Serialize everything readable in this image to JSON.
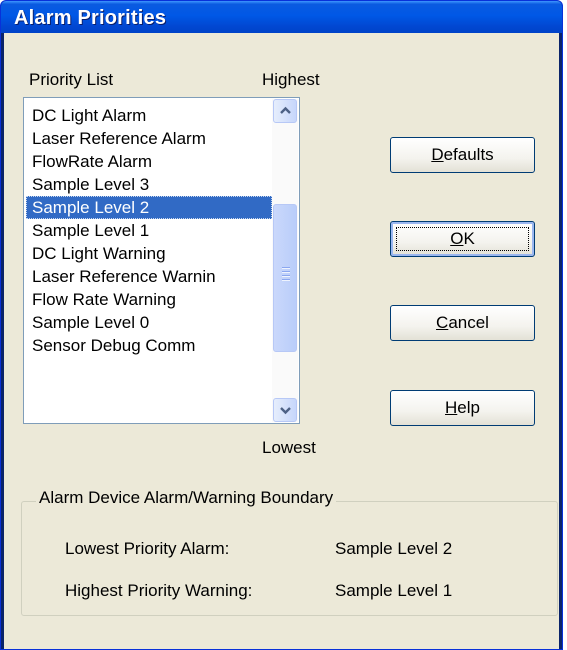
{
  "window": {
    "title": "Alarm Priorities"
  },
  "priority_list": {
    "label": "Priority List",
    "highest_label": "Highest",
    "lowest_label": "Lowest",
    "items": [
      "DC Light Alarm",
      "Laser Reference Alarm",
      "FlowRate Alarm",
      "Sample Level 3",
      "Sample Level 2",
      "Sample Level 1",
      "DC Light Warning",
      "Laser Reference Warnin",
      "Flow Rate Warning",
      "Sample Level 0",
      "Sensor Debug Comm"
    ],
    "selected_index": 4
  },
  "buttons": {
    "defaults": {
      "mnemonic": "D",
      "rest": "efaults"
    },
    "ok": {
      "mnemonic": "O",
      "rest": "K"
    },
    "cancel": {
      "mnemonic": "C",
      "rest": "ancel"
    },
    "help": {
      "mnemonic": "H",
      "rest": "elp"
    }
  },
  "boundary": {
    "title": "Alarm Device Alarm/Warning  Boundary",
    "lowest_alarm_label": "Lowest Priority Alarm:",
    "lowest_alarm_value": "Sample Level 2",
    "highest_warning_label": "Highest Priority Warning:",
    "highest_warning_value": "Sample Level 1"
  },
  "icons": {
    "scroll_up": "chevron-up-icon",
    "scroll_down": "chevron-down-icon",
    "thumb_grip": "grip-icon"
  }
}
